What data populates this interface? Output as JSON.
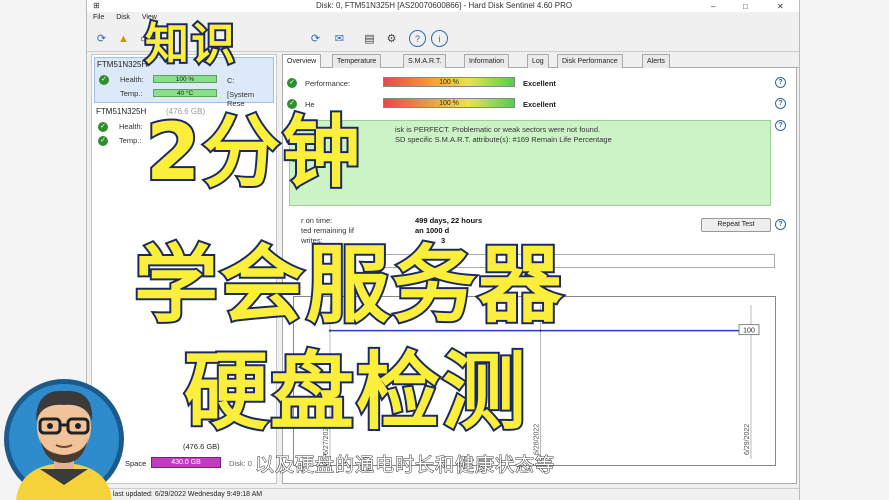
{
  "window": {
    "app_icon_text": "⊞",
    "title": "Disk: 0, FTM51N325H [AS20070600866]  -  Hard Disk Sentinel 4.60 PRO",
    "controls": {
      "minimize": "–",
      "maximize": "□",
      "close": "✕"
    }
  },
  "menu": {
    "items": [
      "File",
      "Disk",
      "View"
    ]
  },
  "sidebar": {
    "disks": [
      {
        "name": "FTM51N325H",
        "health_label": "Health:",
        "health_value": "100 %",
        "health_level": 1.0,
        "health_suffix": "C:",
        "temp_label": "Temp.:",
        "temp_value": "40 °C",
        "temp_suffix": "[System Rese"
      },
      {
        "name": "FTM51N325H",
        "name_suffix": "(476.6 GB)",
        "health_label": "Health:",
        "temp_label": "Temp.:"
      }
    ],
    "capacity": "(476.6 GB)",
    "space_label": "Space",
    "space_value": "430.0 GB",
    "space_disk": "Disk: 0"
  },
  "tabs": [
    {
      "label": "Overview",
      "active": true
    },
    {
      "label": "Temperature"
    },
    {
      "label": "S.M.A.R.T."
    },
    {
      "label": "Information"
    },
    {
      "label": "Log"
    },
    {
      "label": "Disk Performance"
    },
    {
      "label": "Alerts"
    }
  ],
  "overview": {
    "performance_label": "Performance:",
    "performance_value": "100 %",
    "performance_level": 1.0,
    "performance_rating": "Excellent",
    "health_label": "He",
    "health_value": "100 %",
    "health_level": 1.0,
    "health_rating": "Excellent",
    "message_lines": [
      "isk is PERFECT. Problematic or weak sectors were not found.",
      "SD specific S.M.A.R.T. attribute(s):  #169 Remain Life Percentage"
    ],
    "message_fragment": "a",
    "power_on_label": "r on time:",
    "power_on_value": "499 days, 22 hours",
    "remaining_label": "ted remaining lif",
    "remaining_value": "an 1000 d",
    "writes_label": "writes:",
    "writes_value": "3",
    "repeat_test_label": "Repeat Test",
    "help_glyph": "?"
  },
  "chart_data": {
    "type": "line",
    "x": [
      "6/27/2022",
      "6/28/2022",
      "6/29/2022"
    ],
    "series": [
      {
        "values": [
          100,
          100,
          100
        ]
      }
    ],
    "value_label": "100",
    "color": "#1f3fbf"
  },
  "status_bar": {
    "text": "Status last updated: 6/29/2022 Wednesday 9:49:18 AM"
  },
  "overlay": {
    "line1": "知识",
    "line2": "2分钟",
    "line3": "学会服务器",
    "line4": "硬盘检测",
    "caption": "以及硬盘的通电时长和健康状态等"
  },
  "colors": {
    "overlay_fill": "#fcef3c",
    "overlay_stroke": "#1b2a5e",
    "good": "#2f8f2f",
    "message_bg": "#ccf3c6"
  }
}
